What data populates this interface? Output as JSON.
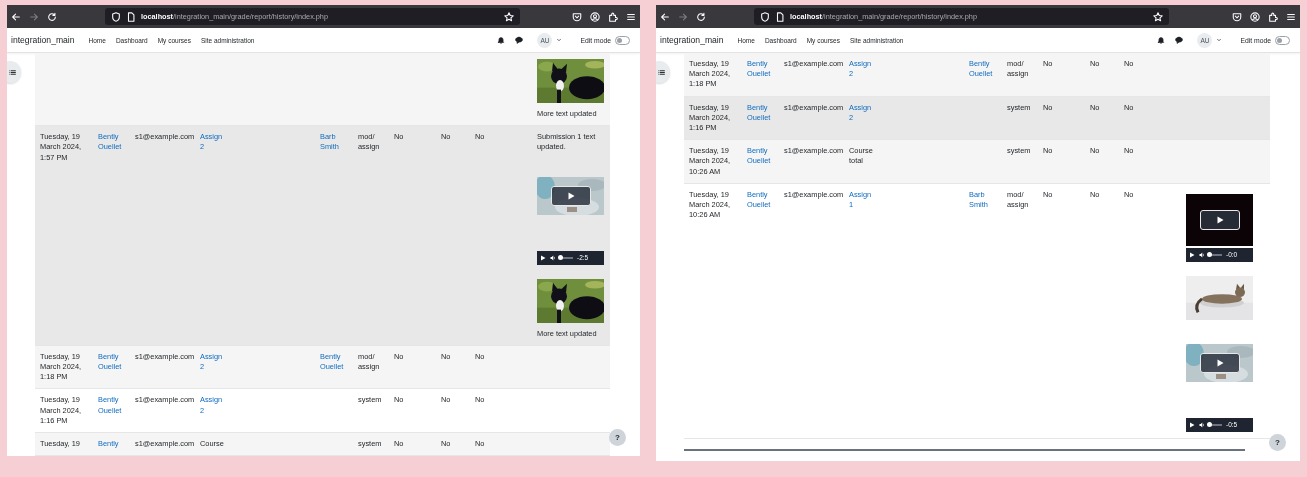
{
  "windows": [
    {
      "url": {
        "host": "localhost",
        "path": "/integration_main/grade/report/history/index.php"
      },
      "nav": {
        "brand": "integration_main",
        "links": [
          "Home",
          "Dashboard",
          "My courses",
          "Site administration"
        ],
        "avatar": "AU",
        "edit_mode": {
          "label": "Edit mode",
          "on": false
        }
      },
      "rows": [
        {
          "hovered": false,
          "feedback": [
            {
              "kind": "picture"
            },
            {
              "kind": "text",
              "text": "More text updated"
            }
          ]
        },
        {
          "hovered": true,
          "date": "Tuesday, 19 March 2024, 1:57 PM",
          "user": "Bently Ouellet",
          "email": "s1@example.com",
          "grade_item": "Assign 2",
          "grade_item_link": true,
          "grader": "Barb Smith",
          "source": "mod/assign",
          "column_7": "No",
          "column_8": "No",
          "column_9": "No",
          "feedback": [
            {
              "kind": "text",
              "text": "Submission 1 text updated."
            },
            {
              "kind": "video"
            },
            {
              "kind": "audio",
              "time": "-2:5",
              "level": 0
            },
            {
              "kind": "picture"
            },
            {
              "kind": "text",
              "text": "More text updated"
            }
          ]
        },
        {
          "hovered": false,
          "date": "Tuesday, 19 March 2024, 1:18 PM",
          "user": "Bently Ouellet",
          "email": "s1@example.com",
          "grade_item": "Assign 2",
          "grade_item_link": true,
          "grader": "Bently Ouellet",
          "source": "mod/assign",
          "column_7": "No",
          "column_8": "No",
          "column_9": "No"
        },
        {
          "hovered": false,
          "date": "Tuesday, 19 March 2024, 1:16 PM",
          "user": "Bently Ouellet",
          "email": "s1@example.com",
          "grade_item": "Assign 2",
          "grade_item_link": true,
          "source": "system",
          "column_7": "No",
          "column_8": "No",
          "column_9": "No"
        },
        {
          "hovered": false,
          "date": "Tuesday, 19",
          "user": "Bently",
          "email": "s1@example.com",
          "grade_item": "Course",
          "grade_item_link": false,
          "source": "system",
          "column_7": "No",
          "column_8": "No",
          "column_9": "No"
        }
      ],
      "footer_rule": false,
      "help": "?"
    },
    {
      "url": {
        "host": "localhost",
        "path": "/integration_main/grade/report/history/index.php"
      },
      "nav": {
        "brand": "integration_main",
        "links": [
          "Home",
          "Dashboard",
          "My courses",
          "Site administration"
        ],
        "avatar": "AU",
        "edit_mode": {
          "label": "Edit mode",
          "on": false
        }
      },
      "rows": [
        {
          "hovered": false,
          "date": "Tuesday, 19 March 2024, 1:18 PM",
          "user": "Bently Ouellet",
          "email": "s1@example.com",
          "grade_item": "Assign 2",
          "grade_item_link": true,
          "grader": "Bently Ouellet",
          "source": "mod/assign",
          "column_7": "No",
          "column_8": "No",
          "column_9": "No"
        },
        {
          "hovered": true,
          "date": "Tuesday, 19 March 2024, 1:16 PM",
          "user": "Bently Ouellet",
          "email": "s1@example.com",
          "grade_item": "Assign 2",
          "grade_item_link": true,
          "source": "system",
          "column_7": "No",
          "column_8": "No",
          "column_9": "No"
        },
        {
          "hovered": false,
          "date": "Tuesday, 19 March 2024, 10:26 AM",
          "user": "Bently Ouellet",
          "email": "s1@example.com",
          "grade_item": "Course total",
          "grade_item_link": false,
          "source": "system",
          "column_7": "No",
          "column_8": "No",
          "column_9": "No"
        },
        {
          "hovered": false,
          "date": "Tuesday, 19 March 2024, 10:26 AM",
          "user": "Bently Ouellet",
          "email": "s1@example.com",
          "grade_item": "Assign 1",
          "grade_item_link": true,
          "grader": "Barb Smith",
          "source": "mod/assign",
          "column_7": "No",
          "column_8": "No",
          "column_9": "No",
          "feedback": [
            {
              "kind": "player",
              "time": "-0:0",
              "level": 0
            },
            {
              "kind": "picture"
            },
            {
              "kind": "video"
            },
            {
              "kind": "audio",
              "time": "-0:5",
              "level": 0
            }
          ]
        }
      ],
      "footer_rule": true,
      "help": "?"
    }
  ]
}
